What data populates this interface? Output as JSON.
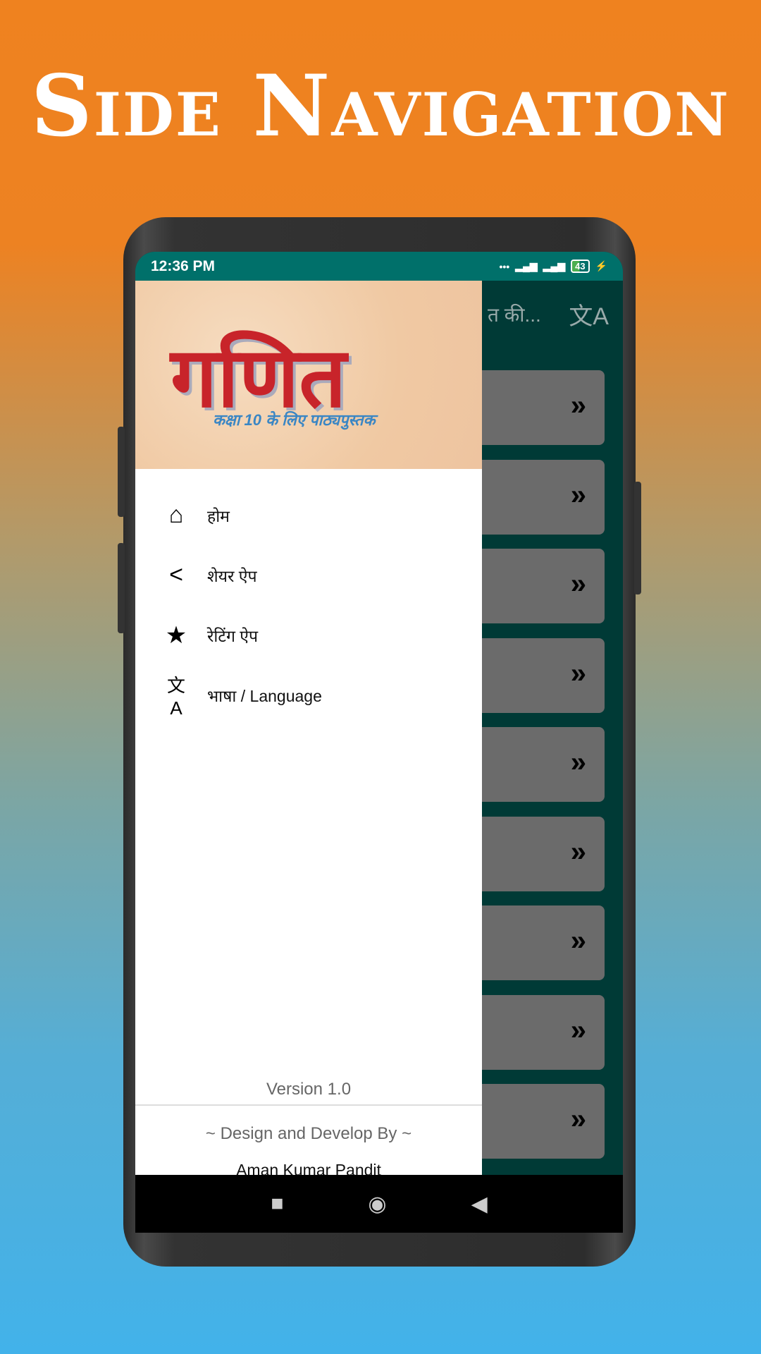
{
  "page_title": "Side Navigation",
  "status_bar": {
    "time": "12:36 PM",
    "battery": "43"
  },
  "app_bar": {
    "title_fragment": "त की...",
    "icon": "translate-icon"
  },
  "cards": [
    {
      "icon": "double-chevron-right-icon"
    },
    {
      "icon": "double-chevron-right-icon"
    },
    {
      "icon": "double-chevron-right-icon"
    },
    {
      "icon": "double-chevron-right-icon"
    },
    {
      "icon": "double-chevron-right-icon"
    },
    {
      "icon": "double-chevron-right-icon"
    },
    {
      "icon": "double-chevron-right-icon"
    },
    {
      "icon": "double-chevron-right-icon"
    },
    {
      "icon": "double-chevron-right-icon"
    }
  ],
  "drawer": {
    "header": {
      "title": "गणित",
      "subtitle": "कक्षा 10 के लिए पाठ्यपुस्तक"
    },
    "items": [
      {
        "label": "होम",
        "icon": "home-icon"
      },
      {
        "label": "शेयर ऐप",
        "icon": "share-icon"
      },
      {
        "label": "रेटिंग ऐप",
        "icon": "star-icon"
      },
      {
        "label": "भाषा / Language",
        "icon": "translate-icon"
      }
    ],
    "version": "Version 1.0",
    "credit": "~  Design and Develop By  ~",
    "author": "Aman Kumar Pandit"
  },
  "colors": {
    "status_bar": "#00706a",
    "accent_logo": "#c8242a"
  }
}
